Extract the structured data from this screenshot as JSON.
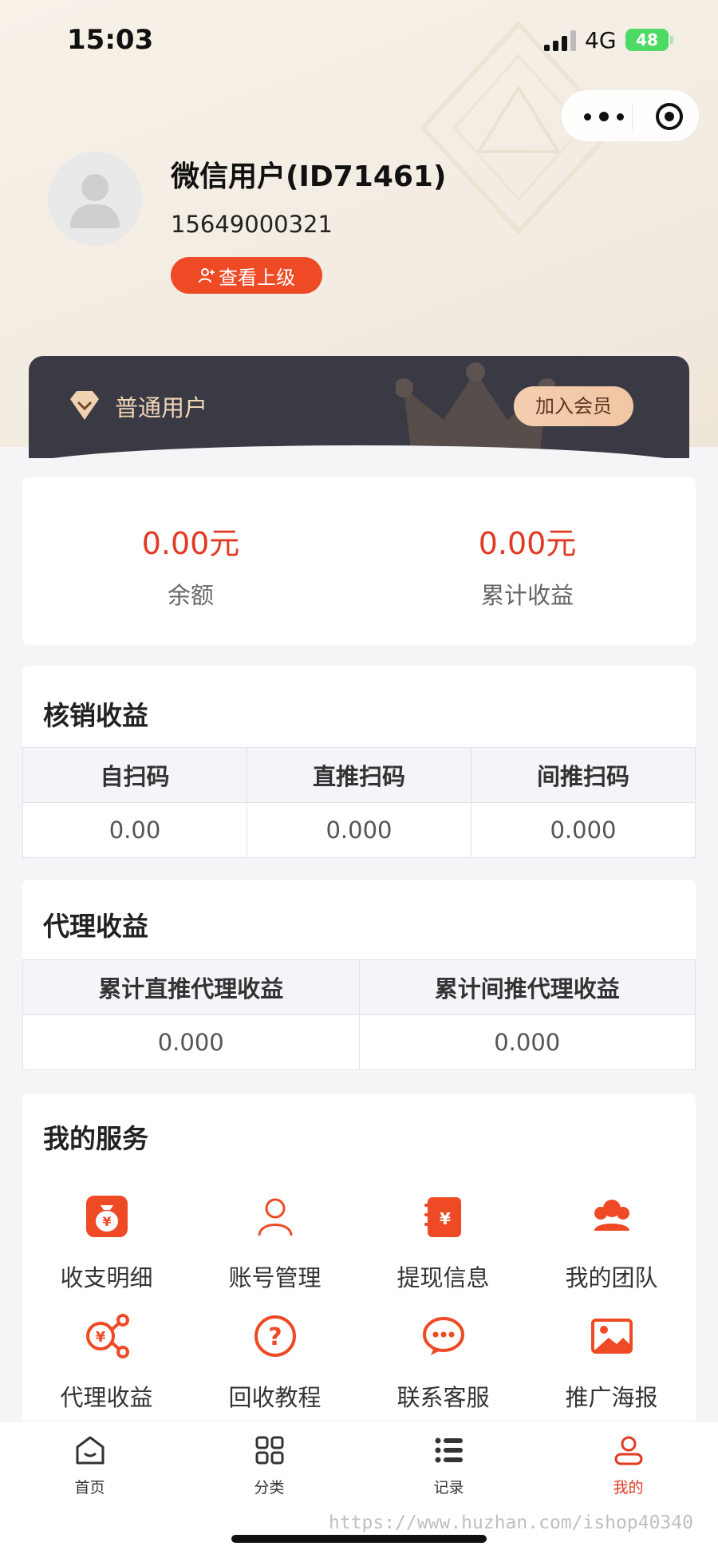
{
  "status_bar": {
    "time": "15:03",
    "network": "4G",
    "battery": "48"
  },
  "profile": {
    "name": "微信用户(ID71461)",
    "phone": "15649000321",
    "superior_button": "查看上级"
  },
  "membership": {
    "level": "普通用户",
    "join_button": "加入会员"
  },
  "balance": [
    {
      "value": "0.00元",
      "label": "余额"
    },
    {
      "value": "0.00元",
      "label": "累计收益"
    }
  ],
  "verify_income": {
    "title": "核销收益",
    "headers": [
      "自扫码",
      "直推扫码",
      "间推扫码"
    ],
    "values": [
      "0.00",
      "0.000",
      "0.000"
    ]
  },
  "agent_income": {
    "title": "代理收益",
    "headers": [
      "累计直推代理收益",
      "累计间推代理收益"
    ],
    "values": [
      "0.000",
      "0.000"
    ]
  },
  "services": {
    "title": "我的服务",
    "items": [
      {
        "label": "收支明细",
        "icon": "money-bag-icon"
      },
      {
        "label": "账号管理",
        "icon": "user-icon"
      },
      {
        "label": "提现信息",
        "icon": "wallet-yen-icon"
      },
      {
        "label": "我的团队",
        "icon": "team-icon"
      },
      {
        "label": "代理收益",
        "icon": "share-yen-icon"
      },
      {
        "label": "回收教程",
        "icon": "question-icon"
      },
      {
        "label": "联系客服",
        "icon": "chat-icon"
      },
      {
        "label": "推广海报",
        "icon": "image-icon"
      }
    ]
  },
  "tabbar": [
    {
      "label": "首页",
      "icon": "home-icon"
    },
    {
      "label": "分类",
      "icon": "grid-icon"
    },
    {
      "label": "记录",
      "icon": "list-icon"
    },
    {
      "label": "我的",
      "icon": "profile-icon",
      "active": true
    }
  ],
  "watermark": "https://www.huzhan.com/ishop40340",
  "colors": {
    "accent": "#ee4a25",
    "value_red": "#e03a22",
    "card_dark": "#3a3a44"
  }
}
